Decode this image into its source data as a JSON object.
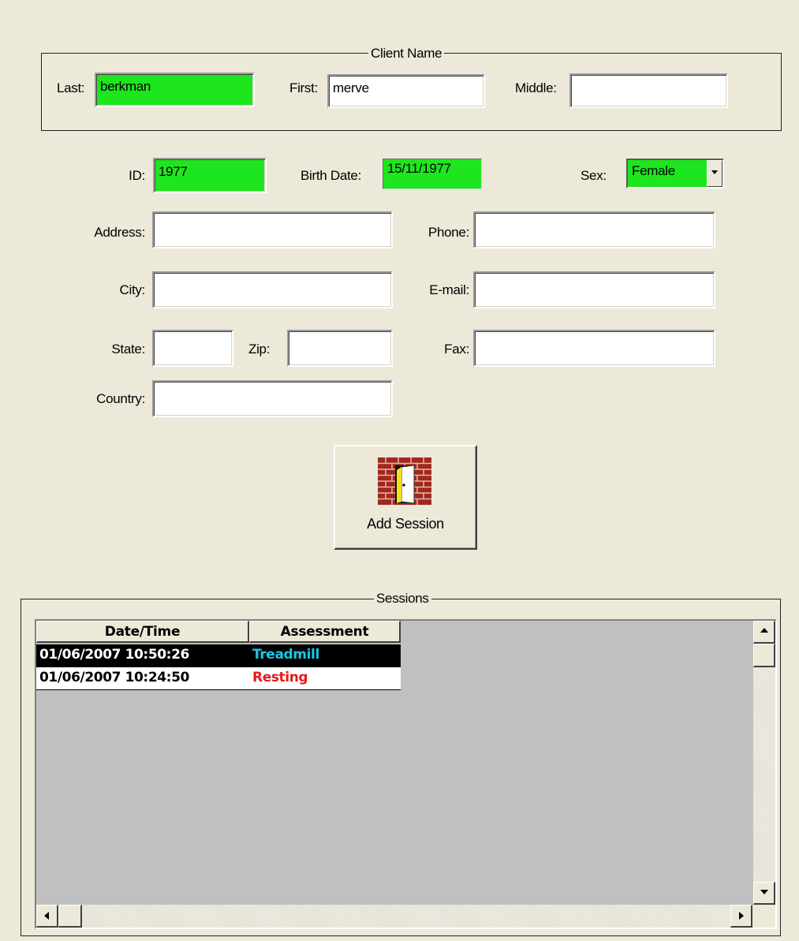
{
  "client_name": {
    "legend": "Client Name",
    "last_label": "Last:",
    "last_value": "berkman",
    "first_label": "First:",
    "first_value": "merve",
    "middle_label": "Middle:",
    "middle_value": ""
  },
  "details": {
    "id_label": "ID:",
    "id_value": "1977",
    "birth_label": "Birth Date:",
    "birth_value": "15/11/1977",
    "sex_label": "Sex:",
    "sex_value": "Female",
    "address_label": "Address:",
    "address_value": "",
    "phone_label": "Phone:",
    "phone_value": "",
    "city_label": "City:",
    "city_value": "",
    "email_label": "E-mail:",
    "email_value": "",
    "state_label": "State:",
    "state_value": "",
    "zip_label": "Zip:",
    "zip_value": "",
    "fax_label": "Fax:",
    "fax_value": "",
    "country_label": "Country:",
    "country_value": ""
  },
  "add_session": {
    "label": "Add Session",
    "icon": "door-exit-icon"
  },
  "sessions": {
    "legend": "Sessions",
    "columns": [
      "Date/Time",
      "Assessment"
    ],
    "rows": [
      {
        "datetime": "01/06/2007 10:50:26",
        "assessment": "Treadmill",
        "color": "#19c8e6",
        "selected": true
      },
      {
        "datetime": "01/06/2007 10:24:50",
        "assessment": "Resting",
        "color": "#e61919",
        "selected": false
      }
    ]
  },
  "colors": {
    "background": "#ece9d8",
    "highlight_field": "#1ee61e",
    "list_background": "#c0c0c0"
  }
}
